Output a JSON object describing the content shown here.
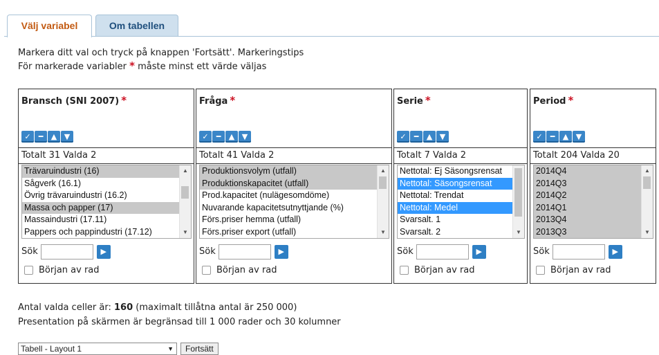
{
  "tabs": [
    {
      "label": "Välj variabel",
      "active": true
    },
    {
      "label": "Om tabellen",
      "active": false
    }
  ],
  "instructions": {
    "line1": "Markera ditt val och tryck på knappen 'Fortsätt'. Markeringstips",
    "line2_before": "För markerade variabler",
    "required_star": "*",
    "line2_after": "måste minst ett värde väljas"
  },
  "icons": {
    "select_all": "check-all-icon",
    "deselect_all": "minus-icon",
    "sort_up": "arrow-up-icon",
    "sort_down": "arrow-down-icon",
    "search_go": "arrow-right-icon"
  },
  "colors": {
    "accent_tab": "#c25a12",
    "selected_blue": "#3399ff",
    "selected_grey": "#c8c8c8",
    "button_blue": "#3a86c8",
    "required_red": "#cc1122"
  },
  "panels": [
    {
      "title": "Bransch (SNI 2007)",
      "count_text": "Totalt 31 Valda 2",
      "options": [
        {
          "label": "Trävaruindustri (16)",
          "selected": "grey"
        },
        {
          "label": "Sågverk (16.1)",
          "selected": ""
        },
        {
          "label": "Övrig trävaruindustri (16.2)",
          "selected": ""
        },
        {
          "label": "Massa och papper (17)",
          "selected": "grey"
        },
        {
          "label": "Massaindustri (17.11)",
          "selected": ""
        },
        {
          "label": "Pappers och pappindustri (17.12)",
          "selected": ""
        }
      ],
      "search_label": "Sök",
      "search_value": "",
      "checkbox_label": "Början av rad"
    },
    {
      "title": "Fråga",
      "count_text": "Totalt 41 Valda 2",
      "options": [
        {
          "label": "Produktionsvolym (utfall)",
          "selected": "grey"
        },
        {
          "label": "Produktionskapacitet (utfall)",
          "selected": "grey"
        },
        {
          "label": "Prod.kapacitet (nulägesomdöme)",
          "selected": ""
        },
        {
          "label": "Nuvarande kapacitetsutnyttjande (%)",
          "selected": ""
        },
        {
          "label": "Förs.priser hemma (utfall)",
          "selected": ""
        },
        {
          "label": "Förs.priser export (utfall)",
          "selected": ""
        }
      ],
      "search_label": "Sök",
      "search_value": "",
      "checkbox_label": "Början av rad"
    },
    {
      "title": "Serie",
      "count_text": "Totalt 7 Valda 2",
      "options": [
        {
          "label": "Nettotal: Ej Säsongsrensat",
          "selected": ""
        },
        {
          "label": "Nettotal: Säsongsrensat",
          "selected": "blue"
        },
        {
          "label": "Nettotal: Trendat",
          "selected": ""
        },
        {
          "label": "Nettotal: Medel",
          "selected": "blue"
        },
        {
          "label": "Svarsalt. 1",
          "selected": ""
        },
        {
          "label": "Svarsalt. 2",
          "selected": ""
        }
      ],
      "search_label": "Sök",
      "search_value": "",
      "checkbox_label": "Början av rad"
    },
    {
      "title": "Period",
      "count_text": "Totalt 204 Valda 20",
      "options": [
        {
          "label": "2014Q4",
          "selected": "grey"
        },
        {
          "label": "2014Q3",
          "selected": "grey"
        },
        {
          "label": "2014Q2",
          "selected": "grey"
        },
        {
          "label": "2014Q1",
          "selected": "grey"
        },
        {
          "label": "2013Q4",
          "selected": "grey"
        },
        {
          "label": "2013Q3",
          "selected": "grey"
        }
      ],
      "search_label": "Sök",
      "search_value": "",
      "checkbox_label": "Början av rad"
    }
  ],
  "summary": {
    "cells_label": "Antal valda celler är:",
    "cells_value": "160",
    "cells_max": "(maximalt tillåtna antal är 250 000)",
    "limit_text": "Presentation på skärmen är begränsad till 1 000 rader och 30 kolumner"
  },
  "layout_select": {
    "value": "Tabell - Layout 1",
    "caret": "▼"
  },
  "continue_label": "Fortsätt"
}
